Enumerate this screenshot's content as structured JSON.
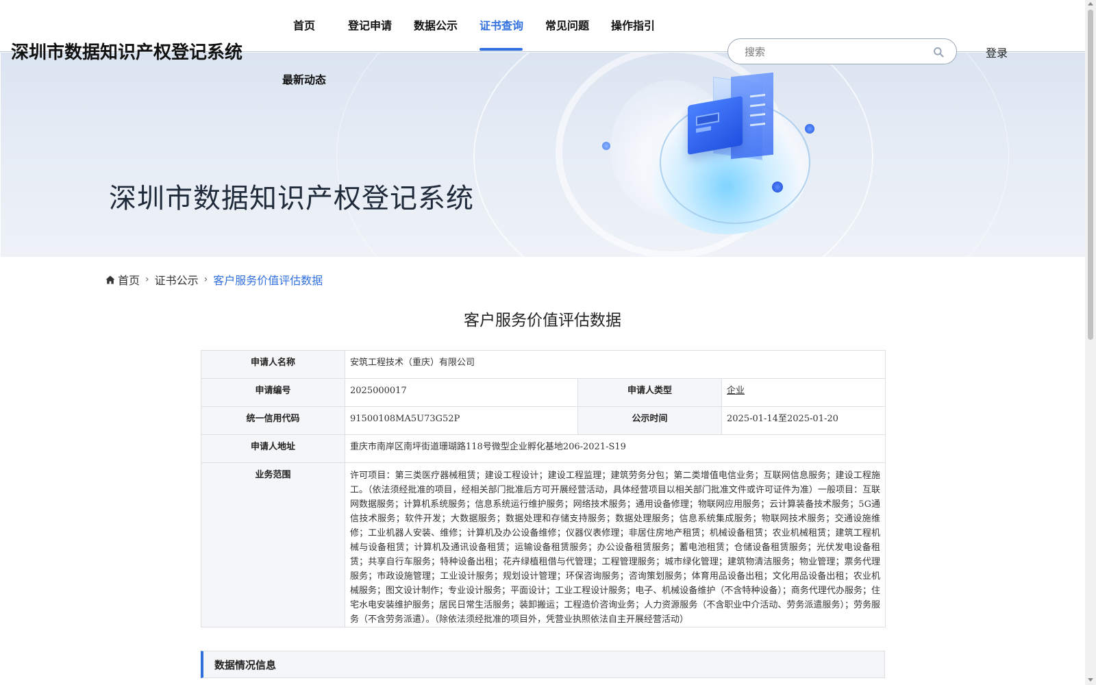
{
  "site": {
    "title": "深圳市数据知识产权登记系统"
  },
  "nav": {
    "items": [
      "首页",
      "登记申请",
      "数据公示",
      "证书查询",
      "常见问题",
      "操作指引",
      "最新动态"
    ],
    "active": "证书查询"
  },
  "search": {
    "placeholder": "搜索",
    "value": ""
  },
  "auth": {
    "login_label": "登录"
  },
  "hero": {
    "title": "深圳市数据知识产权登记系统"
  },
  "breadcrumb": [
    "首页",
    "证书公示",
    "客户服务价值评估数据"
  ],
  "page": {
    "title": "客户服务价值评估数据"
  },
  "details": {
    "applicant_name": {
      "label": "申请人名称",
      "value": "安筑工程技术（重庆）有限公司"
    },
    "application_no": {
      "label": "申请编号",
      "value": "2025000017"
    },
    "applicant_type": {
      "label": "申请人类型",
      "value": "企业"
    },
    "credit_code": {
      "label": "统一信用代码",
      "value": "91500108MA5U73G52P"
    },
    "publicity_time": {
      "label": "公示时间",
      "value": "2025-01-14至2025-01-20"
    },
    "address": {
      "label": "申请人地址",
      "value": "重庆市南岸区南坪街道珊瑚路118号微型企业孵化基地206-2021-S19"
    },
    "business_scope": {
      "label": "业务范围",
      "value": "许可项目：第三类医疗器械租赁；建设工程设计；建设工程监理；建筑劳务分包；第二类增值电信业务；互联网信息服务；建设工程施工。（依法须经批准的项目，经相关部门批准后方可开展经营活动，具体经营项目以相关部门批准文件或许可证件为准）一般项目：互联网数据服务；计算机系统服务；信息系统运行维护服务；网络技术服务；通用设备修理；物联网应用服务；云计算装备技术服务；5G通信技术服务；软件开发；大数据服务；数据处理和存储支持服务；数据处理服务；信息系统集成服务；物联网技术服务；交通设施维修；工业机器人安装、维修；计算机及办公设备维修；仪器仪表修理；非居住房地产租赁；机械设备租赁；农业机械租赁；建筑工程机械与设备租赁；计算机及通讯设备租赁；运输设备租赁服务；办公设备租赁服务；蓄电池租赁；仓储设备租赁服务；光伏发电设备租赁；共享自行车服务；特种设备出租；花卉绿植租借与代管理；工程管理服务；城市绿化管理；建筑物清洁服务；物业管理；票务代理服务；市政设施管理；工业设计服务；规划设计管理；环保咨询服务；咨询策划服务；体育用品设备出租；文化用品设备出租；农业机械服务；图文设计制作；专业设计服务；平面设计；工业工程设计服务；电子、机械设备维护（不含特种设备）；商务代理代办服务；住宅水电安装维护服务；居民日常生活服务；装卸搬运；工程造价咨询业务；人力资源服务（不含职业中介活动、劳务派遣服务）；劳务服务（不含劳务派遣）。（除依法须经批准的项目外，凭营业执照依法自主开展经营活动）"
    }
  },
  "section": {
    "data_info": "数据情况信息"
  },
  "icons": {
    "search": "search-icon",
    "home": "home-icon",
    "breadcrumb_separator": "chevron-right-icon"
  },
  "colors": {
    "accent": "#2f6fde",
    "label_bg": "#f5f6f8",
    "border": "#dcdfe4"
  }
}
